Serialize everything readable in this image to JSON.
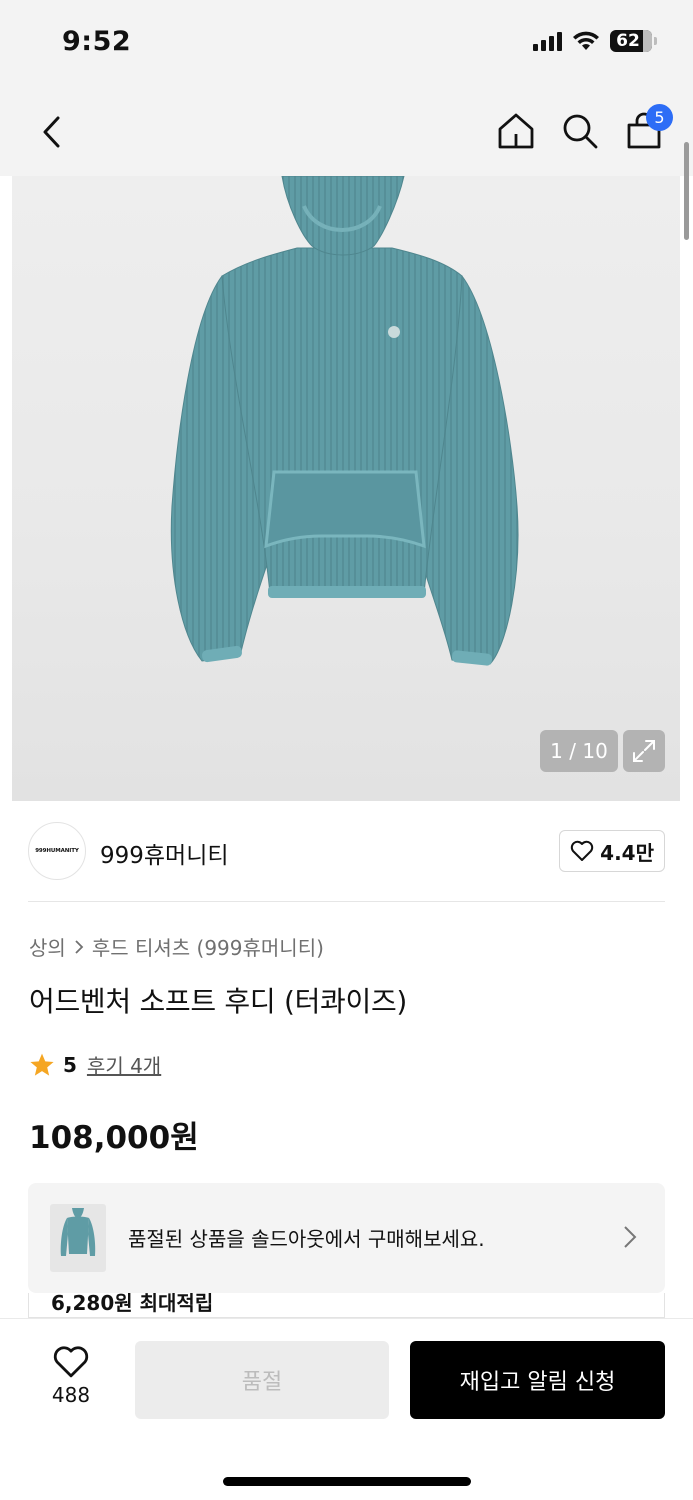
{
  "status_bar": {
    "time": "9:52",
    "battery": "62"
  },
  "nav": {
    "cart_count": "5"
  },
  "gallery": {
    "counter": "1 / 10"
  },
  "brand": {
    "logo_text": "999HUMANITY",
    "name": "999휴머니티",
    "likes": "4.4만"
  },
  "product": {
    "breadcrumb": [
      "상의",
      "후드 티셔츠 (999휴머니티)"
    ],
    "title": "어드벤처 소프트 후디 (터콰이즈)",
    "rating": "5",
    "reviews": "후기 4개",
    "price": "108,000원"
  },
  "soldout_banner": {
    "text": "품절된 상품을 솔드아웃에서 구매해보세요."
  },
  "reward": {
    "text": "6,280원 최대적립"
  },
  "bottom_bar": {
    "wish_count": "488",
    "soldout_label": "품절",
    "restock_label": "재입고 알림 신청"
  },
  "colors": {
    "accent_badge": "#2d6df6",
    "star": "#f5a623",
    "hoodie": "#5e9aa3",
    "primary_button": "#000000"
  },
  "icons": [
    "back-icon",
    "home-icon",
    "search-icon",
    "cart-icon",
    "expand-icon",
    "heart-icon",
    "star-icon",
    "chevron-right-icon"
  ]
}
